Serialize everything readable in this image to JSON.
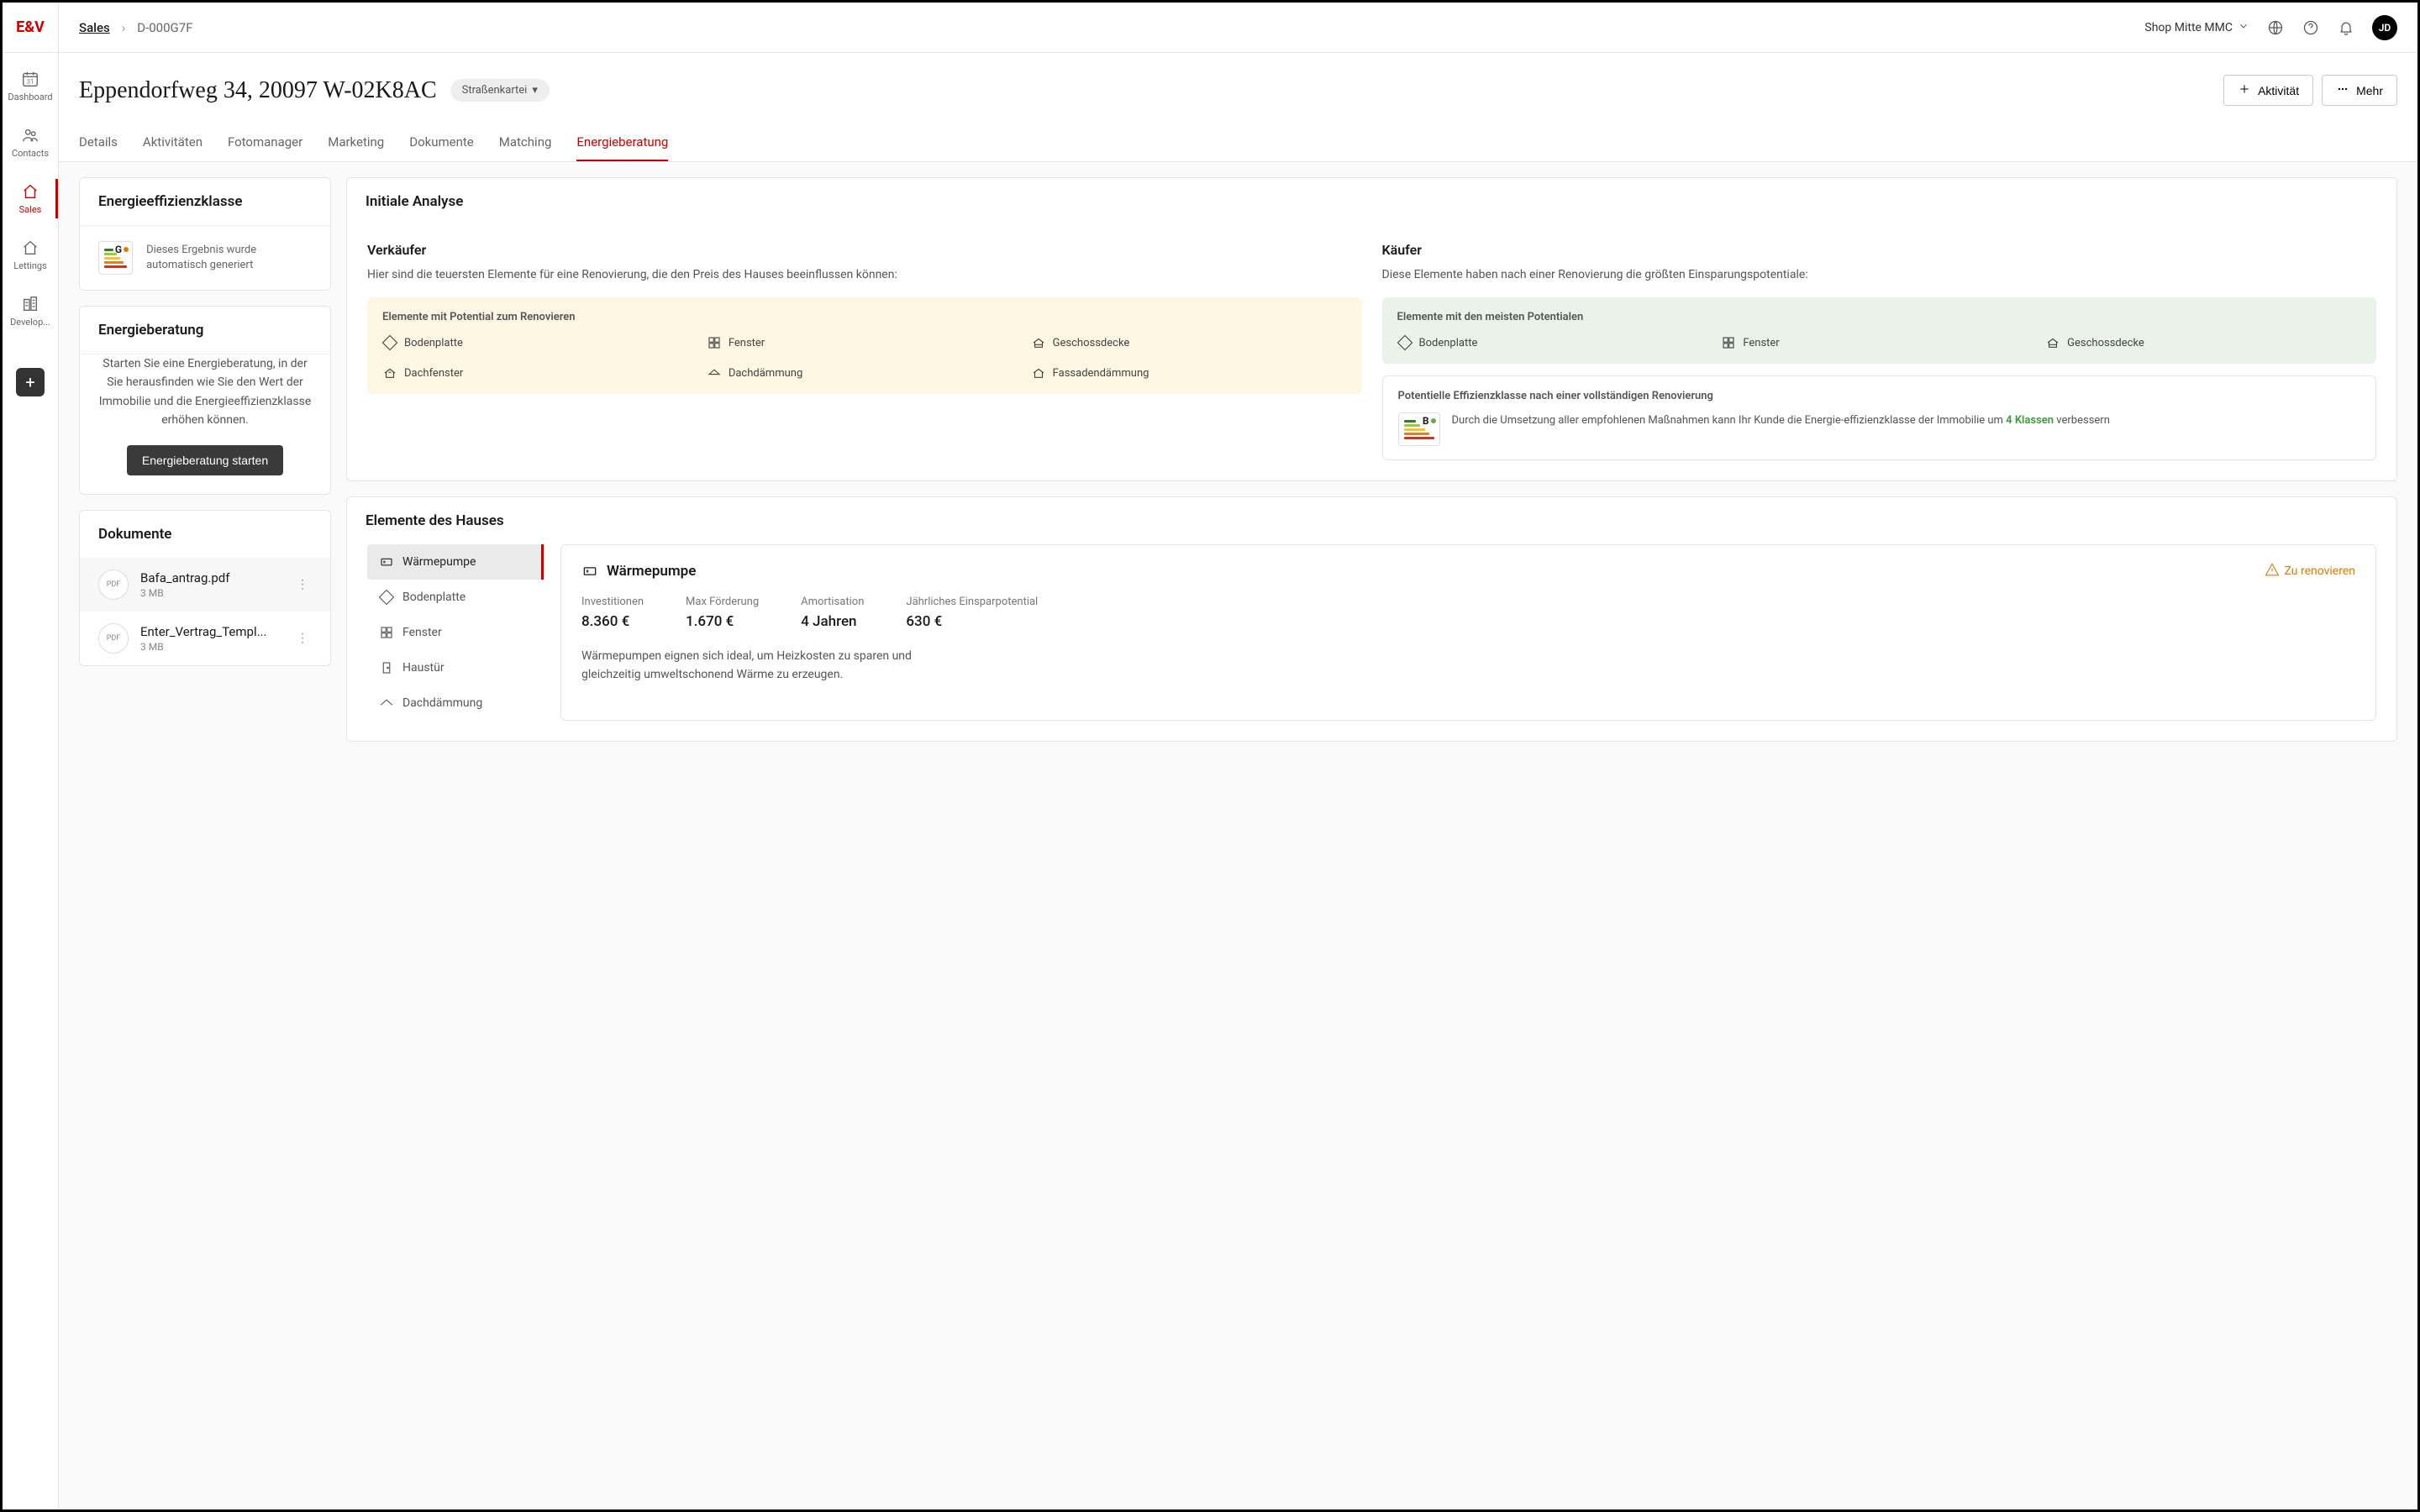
{
  "logo": "E&V",
  "nav": {
    "dashboard": "Dashboard",
    "contacts": "Contacts",
    "sales": "Sales",
    "lettings": "Lettings",
    "developments": "Develop..."
  },
  "breadcrumb": {
    "root": "Sales",
    "id": "D-000G7F"
  },
  "topbar": {
    "shop": "Shop Mitte MMC",
    "avatar": "JD"
  },
  "page": {
    "title": "Eppendorfweg  34, 20097 W-02K8AC",
    "tag": "Straßenkartei",
    "action_activity": "Aktivität",
    "action_more": "Mehr"
  },
  "tabs": [
    "Details",
    "Aktivitäten",
    "Fotomanager",
    "Marketing",
    "Dokumente",
    "Matching",
    "Energieberatung"
  ],
  "active_tab": 6,
  "efficiency": {
    "title": "Energieeffizienzklasse",
    "letter": "G",
    "dot_color": "#e07b00",
    "note": "Dieses Ergebnis wurde automatisch generiert"
  },
  "advice": {
    "title": "Energieberatung",
    "body": "Starten Sie eine Energieberatung, in der Sie herausfinden wie Sie den Wert der Immobilie und die Energieeffizienzklasse erhöhen können.",
    "button": "Energieberatung starten"
  },
  "documents": {
    "title": "Dokumente",
    "items": [
      {
        "name": "Bafa_antrag.pdf",
        "size": "3 MB"
      },
      {
        "name": "Enter_Vertrag_Templ...",
        "size": "3 MB"
      }
    ]
  },
  "analysis": {
    "title": "Initiale Analyse",
    "seller": {
      "heading": "Verkäufer",
      "text": "Hier sind die teuersten Elemente für eine Renovierung, die den Preis des Hauses beeinflussen können:",
      "box_title": "Elemente mit Potential zum Renovieren",
      "items": [
        "Bodenplatte",
        "Fenster",
        "Geschossdecke",
        "Dachfenster",
        "Dachdämmung",
        "Fassadendämmung"
      ]
    },
    "buyer": {
      "heading": "Käufer",
      "text": "Diese Elemente haben nach einer Renovierung die größten Einsparungspotentiale:",
      "box_title": "Elemente mit den meisten Potentialen",
      "items": [
        "Bodenplatte",
        "Fenster",
        "Geschossdecke"
      ]
    },
    "potential": {
      "title": "Potentielle Effizienzklasse nach einer vollständigen Renovierung",
      "letter": "B",
      "dot_color": "#6aa84f",
      "text_pre": "Durch die Umsetzung aller empfohlenen Maßnahmen kann Ihr Kunde die Energie-effizienzklasse der Immobilie um ",
      "highlight": "4 Klassen",
      "text_post": " verbessern"
    }
  },
  "house": {
    "title": "Elemente des Hauses",
    "list": [
      "Wärmepumpe",
      "Bodenplatte",
      "Fenster",
      "Haustür",
      "Dachdämmung"
    ],
    "active": 0,
    "detail": {
      "title": "Wärmepumpe",
      "renovate": "Zu renovieren",
      "stats": [
        {
          "label": "Investitionen",
          "value": "8.360 €"
        },
        {
          "label": "Max Förderung",
          "value": "1.670 €"
        },
        {
          "label": "Amortisation",
          "value": "4 Jahren"
        },
        {
          "label": "Jährliches Einsparpotential",
          "value": "630 €"
        }
      ],
      "description": "Wärmepumpen eignen sich ideal, um Heizkosten zu sparen und gleichzeitig umweltschonend Wärme zu erzeugen."
    }
  }
}
